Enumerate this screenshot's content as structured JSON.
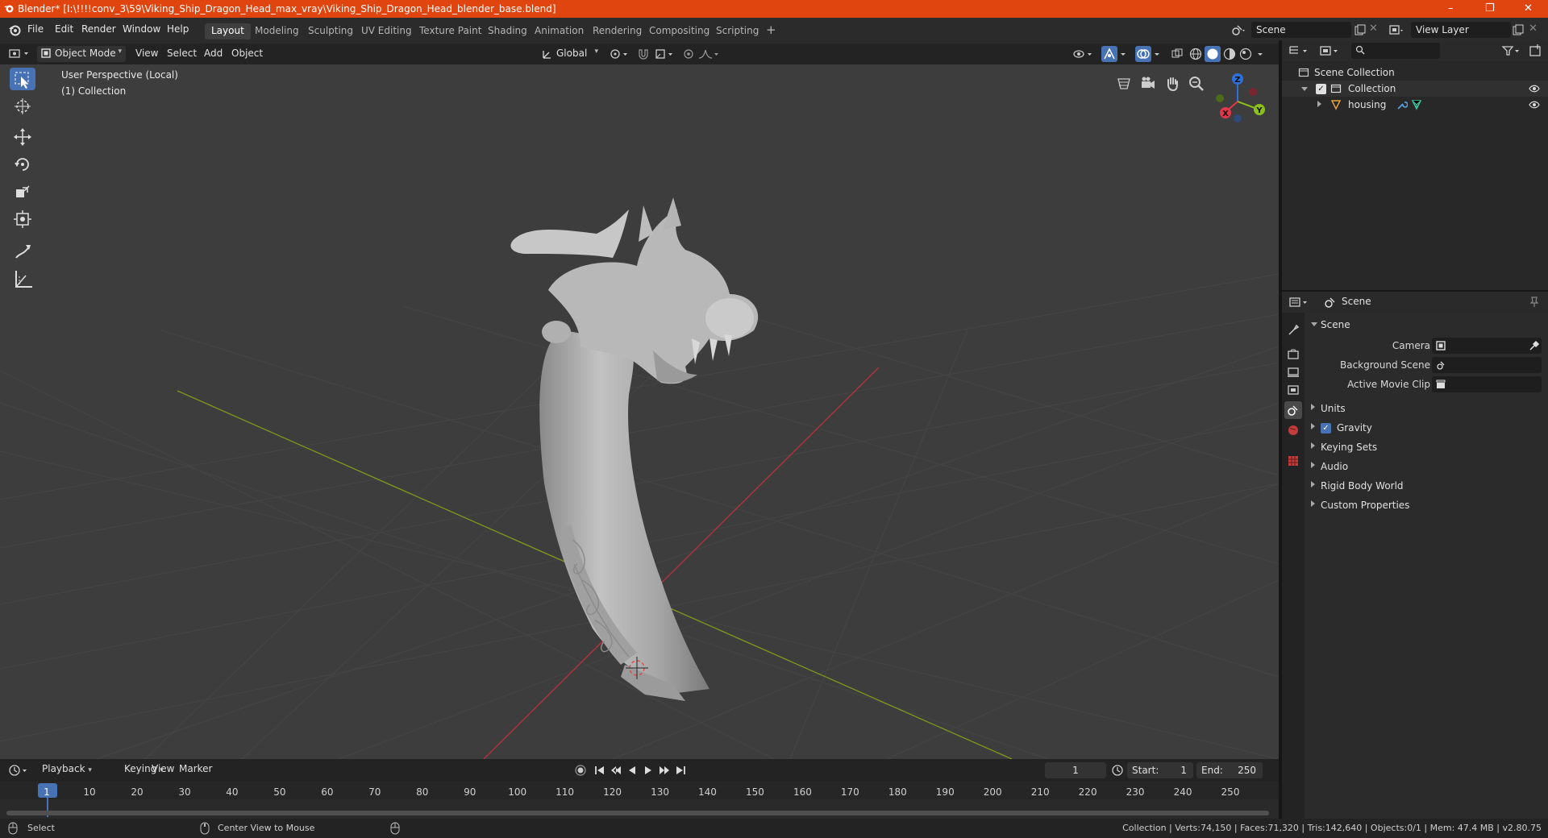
{
  "window": {
    "title": "Blender* [I:\\!!!!conv_3\\59\\Viking_Ship_Dragon_Head_max_vray\\Viking_Ship_Dragon_Head_blender_base.blend]",
    "minimize": "–",
    "maximize": "❐",
    "close": "✕"
  },
  "menu": {
    "items": [
      "File",
      "Edit",
      "Render",
      "Window",
      "Help"
    ]
  },
  "workspaces": {
    "tabs": [
      "Layout",
      "Modeling",
      "Sculpting",
      "UV Editing",
      "Texture Paint",
      "Shading",
      "Animation",
      "Rendering",
      "Compositing",
      "Scripting"
    ],
    "active": "Layout",
    "add": "+"
  },
  "scene_selector": {
    "value": "Scene"
  },
  "view_layer_selector": {
    "value": "View Layer"
  },
  "viewport_header": {
    "mode": "Object Mode",
    "menus": [
      "View",
      "Select",
      "Add",
      "Object"
    ],
    "orientation": "Global"
  },
  "viewport": {
    "perspective_label": "User Perspective (Local)",
    "collection_label": "(1) Collection",
    "gizmo": {
      "x": "X",
      "y": "Y",
      "z": "Z"
    }
  },
  "outliner": {
    "search_placeholder": "",
    "items": [
      {
        "label": "Scene Collection"
      },
      {
        "label": "Collection"
      },
      {
        "label": "housing"
      }
    ]
  },
  "properties": {
    "context": "Scene",
    "section": "Scene",
    "fields": [
      {
        "label": "Camera",
        "value": ""
      },
      {
        "label": "Background Scene",
        "value": ""
      },
      {
        "label": "Active Movie Clip",
        "value": ""
      }
    ],
    "panels": [
      "Units",
      "Gravity",
      "Keying Sets",
      "Audio",
      "Rigid Body World",
      "Custom Properties"
    ],
    "gravity_checked": true
  },
  "timeline": {
    "menus": [
      "Playback",
      "Keying",
      "View",
      "Marker"
    ],
    "current_frame": "1",
    "start_label": "Start:",
    "start": "1",
    "end_label": "End:",
    "end": "250",
    "ticks": [
      "1",
      "10",
      "20",
      "30",
      "40",
      "50",
      "60",
      "70",
      "80",
      "90",
      "100",
      "110",
      "120",
      "130",
      "140",
      "150",
      "160",
      "170",
      "180",
      "190",
      "200",
      "210",
      "220",
      "230",
      "240",
      "250"
    ]
  },
  "status": {
    "select": "Select",
    "center_view": "Center View to Mouse",
    "stats": "Collection | Verts:74,150 | Faces:71,320 | Tris:142,640 | Objects:0/1 | Mem: 47.4 MB | v2.80.75"
  },
  "colors": {
    "title_bar": "#e0440f",
    "active_blue": "#4772b3",
    "viewport_bg": "#3d3d3d",
    "axis_x": "#b8323d",
    "axis_y": "#7f9a1c"
  }
}
